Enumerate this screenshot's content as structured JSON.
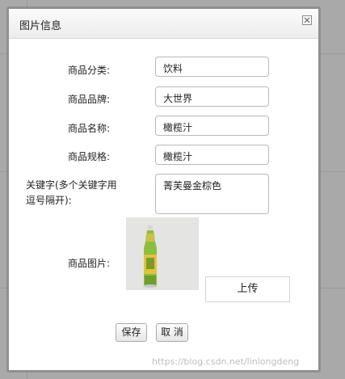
{
  "dialog": {
    "title": "图片信息",
    "close_icon": "close-icon"
  },
  "form": {
    "category": {
      "label": "商品分类:",
      "value": "饮料"
    },
    "brand": {
      "label": "商品品牌:",
      "value": "大世界"
    },
    "name": {
      "label": "商品名称:",
      "value": "橄榄汁"
    },
    "spec": {
      "label": "商品规格:",
      "value": "橄榄汁"
    },
    "keywords": {
      "label": "关键字(多个关键字用逗号隔开):",
      "value": "菁芙曼金棕色"
    },
    "image": {
      "label": "商品图片:"
    }
  },
  "buttons": {
    "upload": "上传",
    "save": "保存",
    "cancel": "取 消"
  },
  "watermark": "https://blog.csdn.net/linlongdeng",
  "colors": {
    "backdrop": "#a9a9a9",
    "dialog_border": "#8f8f8f",
    "bottle_green": "#8cbf3f"
  }
}
